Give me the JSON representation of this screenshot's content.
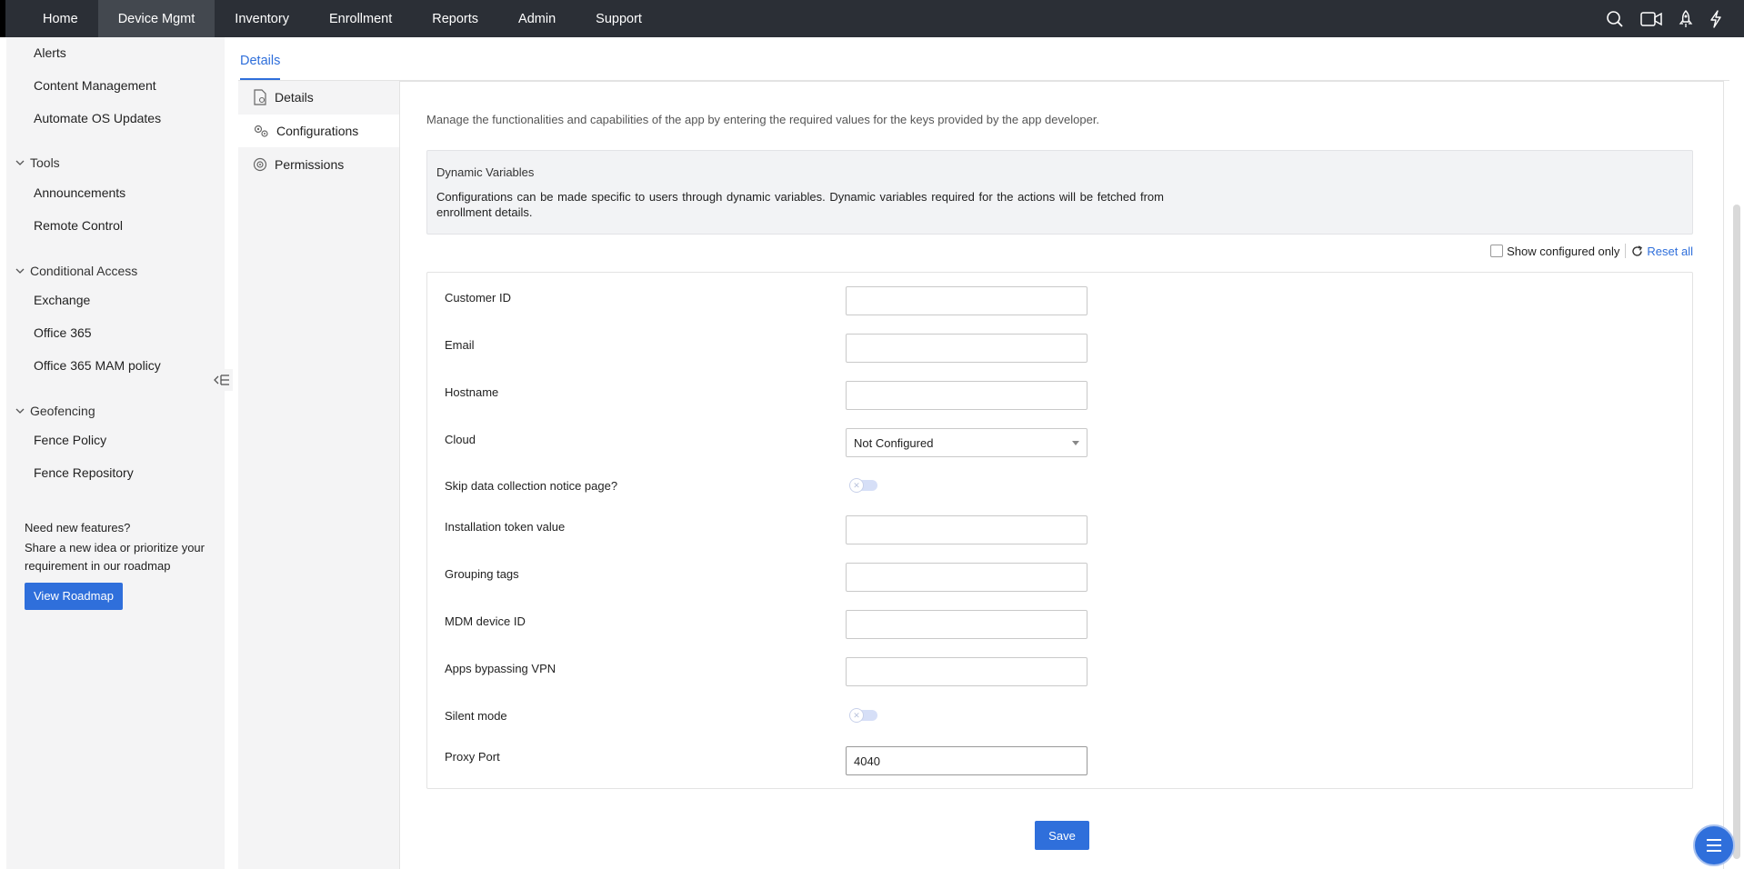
{
  "topnav": {
    "items": [
      {
        "label": "Home",
        "active": false
      },
      {
        "label": "Device Mgmt",
        "active": true
      },
      {
        "label": "Inventory",
        "active": false
      },
      {
        "label": "Enrollment",
        "active": false
      },
      {
        "label": "Reports",
        "active": false
      },
      {
        "label": "Admin",
        "active": false
      },
      {
        "label": "Support",
        "active": false
      }
    ],
    "icons": [
      "search-icon",
      "video-icon",
      "rocket-icon",
      "lightning-icon"
    ]
  },
  "sidebar": {
    "items_top": [
      "Alerts",
      "Content Management",
      "Automate OS Updates"
    ],
    "groups": [
      {
        "label": "Tools",
        "items": [
          "Announcements",
          "Remote Control"
        ]
      },
      {
        "label": "Conditional Access",
        "items": [
          "Exchange",
          "Office 365",
          "Office 365 MAM policy"
        ]
      },
      {
        "label": "Geofencing",
        "items": [
          "Fence Policy",
          "Fence Repository"
        ]
      }
    ],
    "promo": {
      "line1": "Need new features?",
      "line2": "Share a new idea or prioritize your requirement in our roadmap",
      "button": "View Roadmap"
    }
  },
  "content": {
    "tab": "Details",
    "inner_nav": [
      {
        "label": "Details",
        "icon": "document-icon",
        "active": false
      },
      {
        "label": "Configurations",
        "icon": "gears-icon",
        "active": true
      },
      {
        "label": "Permissions",
        "icon": "shield-gear-icon",
        "active": false
      }
    ],
    "intro": "Manage the functionalities and capabilities of the app by entering the required values for the keys provided by the app developer.",
    "dynamic": {
      "title": "Dynamic Variables",
      "text": "Configurations can be made specific to users through dynamic variables. Dynamic variables required for the actions will be fetched from enrollment details."
    },
    "filters": {
      "show_configured": "Show configured only",
      "reset": "Reset all"
    },
    "fields": [
      {
        "label": "Customer ID",
        "type": "text",
        "value": ""
      },
      {
        "label": "Email",
        "type": "text",
        "value": ""
      },
      {
        "label": "Hostname",
        "type": "text",
        "value": ""
      },
      {
        "label": "Cloud",
        "type": "select",
        "value": "Not Configured"
      },
      {
        "label": "Skip data collection notice page?",
        "type": "toggle",
        "value": "off"
      },
      {
        "label": "Installation token value",
        "type": "text",
        "value": ""
      },
      {
        "label": "Grouping tags",
        "type": "text",
        "value": ""
      },
      {
        "label": "MDM device ID",
        "type": "text",
        "value": ""
      },
      {
        "label": "Apps bypassing VPN",
        "type": "text",
        "value": ""
      },
      {
        "label": "Silent mode",
        "type": "toggle",
        "value": "off"
      },
      {
        "label": "Proxy Port",
        "type": "text",
        "value": "4040"
      }
    ],
    "save": "Save"
  },
  "colors": {
    "topbar": "#2b2f36",
    "accent": "#2f6fdb",
    "sidebar_bg": "#f4f4f5"
  }
}
